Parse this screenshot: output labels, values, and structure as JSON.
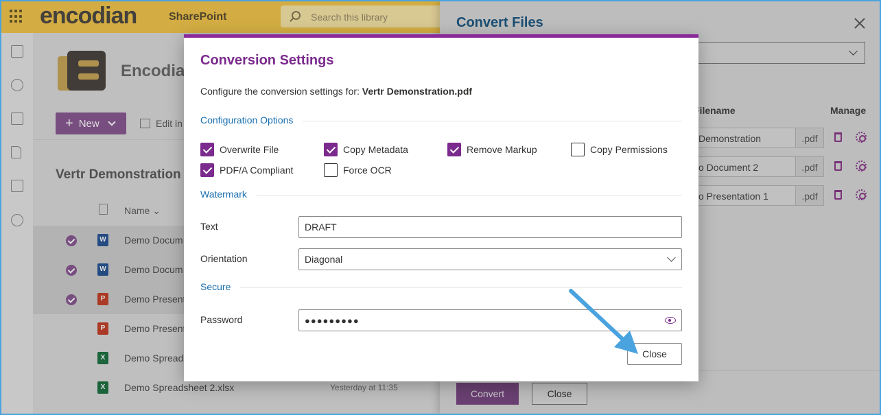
{
  "suite": {
    "brand": "encodian",
    "app": "SharePoint",
    "search_placeholder": "Search this library"
  },
  "site": {
    "title": "Encodian"
  },
  "commands": {
    "new_label": "New",
    "edit_label": "Edit in"
  },
  "library": {
    "title": "Vertr Demonstration",
    "name_header": "Name",
    "rows": [
      {
        "name": "Demo Docum",
        "type": "W",
        "selected": true,
        "modified": ""
      },
      {
        "name": "Demo Docum",
        "type": "W",
        "selected": true,
        "modified": ""
      },
      {
        "name": "Demo Present",
        "type": "P",
        "selected": true,
        "modified": ""
      },
      {
        "name": "Demo Present",
        "type": "P",
        "selected": false,
        "modified": ""
      },
      {
        "name": "Demo Spreads",
        "type": "X",
        "selected": false,
        "modified": ""
      },
      {
        "name": "Demo Spreadsheet 2.xlsx",
        "type": "X",
        "selected": false,
        "modified": "Yesterday at 11:35"
      }
    ]
  },
  "panel": {
    "title": "Convert Files",
    "filename_header": "Filename",
    "manage_header": "Manage",
    "files": [
      {
        "name": "Demonstration",
        "ext": ".pdf"
      },
      {
        "name": "o Document 2",
        "ext": ".pdf"
      },
      {
        "name": "o Presentation 1",
        "ext": ".pdf"
      }
    ],
    "convert_label": "Convert",
    "close_label": "Close"
  },
  "modal": {
    "title": "Conversion Settings",
    "description_prefix": "Configure the conversion settings for: ",
    "file_name": "Vertr Demonstration.pdf",
    "config_section": "Configuration Options",
    "options": {
      "overwrite_file": {
        "label": "Overwrite File",
        "checked": true
      },
      "copy_metadata": {
        "label": "Copy Metadata",
        "checked": true
      },
      "remove_markup": {
        "label": "Remove Markup",
        "checked": true
      },
      "copy_permissions": {
        "label": "Copy Permissions",
        "checked": false
      },
      "pdfa_compliant": {
        "label": "PDF/A Compliant",
        "checked": true
      },
      "force_ocr": {
        "label": "Force OCR",
        "checked": false
      }
    },
    "watermark_section": "Watermark",
    "text_label": "Text",
    "text_value": "DRAFT",
    "orientation_label": "Orientation",
    "orientation_value": "Diagonal",
    "secure_section": "Secure",
    "password_label": "Password",
    "password_value": "●●●●●●●●●",
    "close_label": "Close"
  },
  "colors": {
    "accent": "#7b2a8d",
    "section_blue": "#1a6fb0",
    "suite_yellow": "#f3c74d",
    "annotation_arrow": "#4aa3df"
  },
  "icons": [
    "waffle-icon",
    "search-icon",
    "home-icon",
    "globe-icon",
    "news-icon",
    "file-icon",
    "list-icon",
    "add-icon",
    "trash-icon",
    "gear-icon",
    "eye-icon",
    "chevron-down-icon",
    "close-icon"
  ]
}
